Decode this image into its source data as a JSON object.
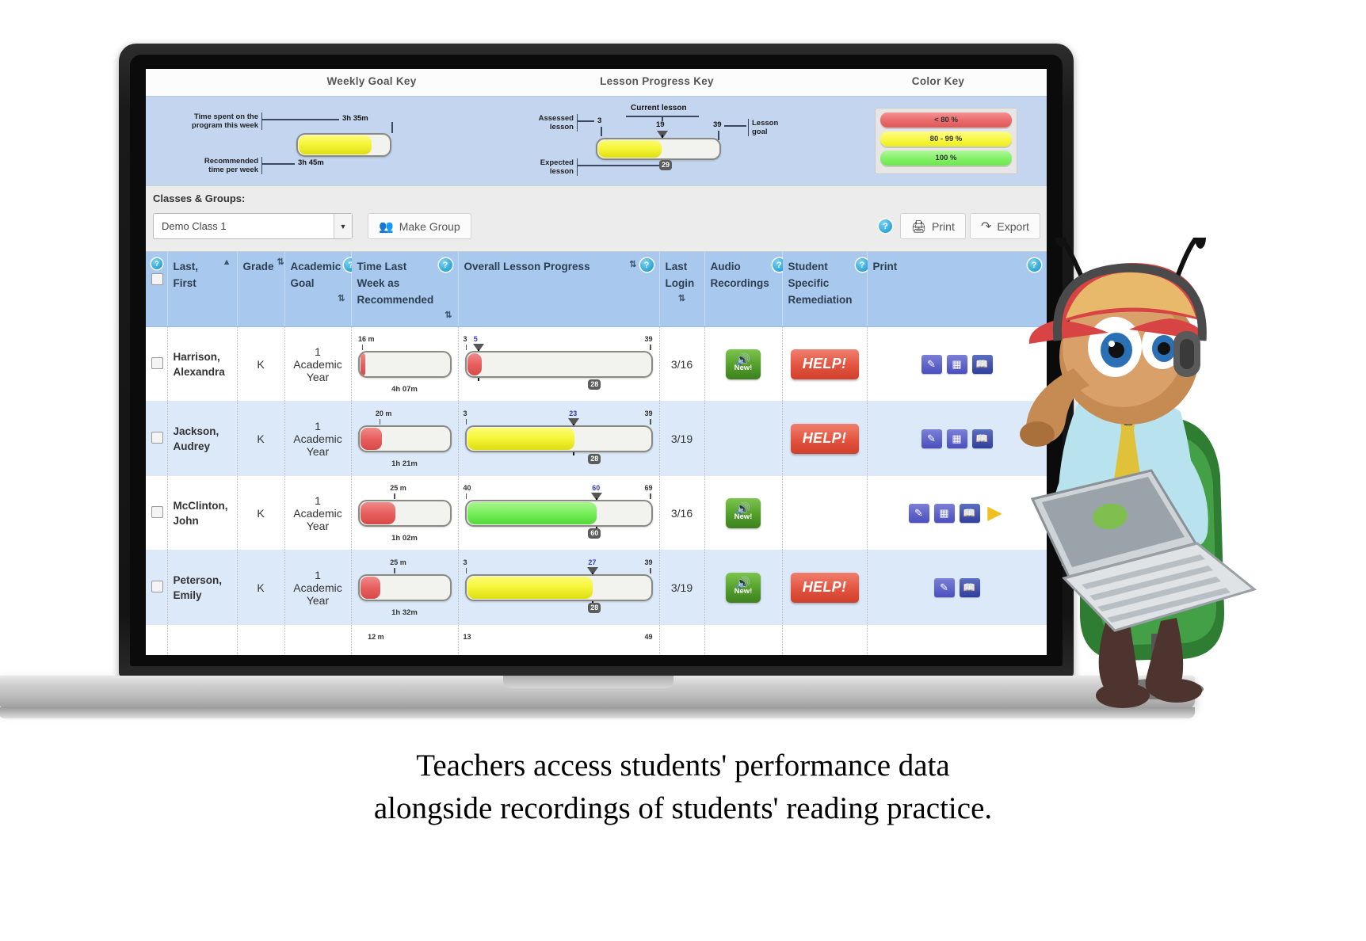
{
  "caption": {
    "line1": "Teachers access students' performance data",
    "line2": "alongside recordings of students' reading practice."
  },
  "keys": {
    "weekly_goal_title": "Weekly Goal Key",
    "lesson_progress_title": "Lesson Progress Key",
    "color_key_title": "Color Key",
    "weekly_goal": {
      "label_time_spent": "Time spent on the\nprogram this week",
      "value_time_spent": "3h 35m",
      "label_recommended": "Recommended\ntime per week",
      "value_recommended": "3h 45m"
    },
    "lesson_progress": {
      "label_assessed": "Assessed\nlesson",
      "label_expected": "Expected\nlesson",
      "label_current": "Current lesson",
      "label_goal": "Lesson\ngoal",
      "value_assessed": "3",
      "value_current": "19",
      "value_goal": "39",
      "value_expected": "29"
    },
    "color_key": {
      "items": [
        {
          "label": "< 80 %",
          "color": "#e96a6a"
        },
        {
          "label": "80 - 99 %",
          "color": "#f7f742"
        },
        {
          "label": "100 %",
          "color": "#83f067"
        }
      ]
    }
  },
  "toolbar": {
    "classes_label": "Classes & Groups:",
    "selected_class": "Demo Class 1",
    "make_group_label": "Make Group",
    "print_label": "Print",
    "export_label": "Export",
    "help_char": "?"
  },
  "table": {
    "columns": [
      {
        "label": "Last, First",
        "sort": "▲",
        "help": false
      },
      {
        "label": "Grade",
        "sort": "⇅",
        "help": true
      },
      {
        "label": "Academic Goal",
        "sort": "⇅",
        "help": true
      },
      {
        "label": "Time Last Week as Recommended",
        "sort": "⇅",
        "help": true
      },
      {
        "label": "Overall Lesson Progress",
        "sort": "⇅",
        "help": true
      },
      {
        "label": "Last Login",
        "sort": "⇅",
        "help": false
      },
      {
        "label": "Audio Recordings",
        "sort": "",
        "help": true
      },
      {
        "label": "Student Specific Remediation",
        "sort": "",
        "help": true
      },
      {
        "label": "Print",
        "sort": "",
        "help": true
      }
    ],
    "rows": [
      {
        "name": "Harrison, Alexandra",
        "grade": "K",
        "academic_goal": "1 Academic Year",
        "time_top_label": "16 m",
        "time_under_label": "4h 07m",
        "time_fill_pct": 6,
        "time_fill_color": "red",
        "time_tick_pct": 6,
        "lesson_start": "3",
        "lesson_end": "39",
        "lesson_current": "5",
        "lesson_expected": "28",
        "lesson_fill_pct": 8,
        "lesson_fill_color": "red",
        "lesson_current_pct": 8,
        "lesson_expected_pct": 70,
        "last_login": "3/16",
        "audio": "New!",
        "remediation": "HELP!",
        "print_icons": [
          "report-icon",
          "chart-icon",
          "book-icon"
        ]
      },
      {
        "name": "Jackson, Audrey",
        "grade": "K",
        "academic_goal": "1 Academic Year",
        "time_top_label": "20 m",
        "time_under_label": "1h 21m",
        "time_fill_pct": 24,
        "time_fill_color": "red",
        "time_tick_pct": 24,
        "lesson_start": "3",
        "lesson_end": "39",
        "lesson_current": "23",
        "lesson_expected": "28",
        "lesson_fill_pct": 58,
        "lesson_fill_color": "yellow",
        "lesson_current_pct": 58,
        "lesson_expected_pct": 70,
        "last_login": "3/19",
        "audio": "",
        "remediation": "HELP!",
        "print_icons": [
          "report-icon",
          "chart-icon",
          "book-icon"
        ]
      },
      {
        "name": "McClinton, John",
        "grade": "K",
        "academic_goal": "1 Academic Year",
        "time_top_label": "25 m",
        "time_under_label": "1h 02m",
        "time_fill_pct": 39,
        "time_fill_color": "red",
        "time_tick_pct": 39,
        "lesson_start": "40",
        "lesson_end": "69",
        "lesson_current": "60",
        "lesson_expected": "60",
        "lesson_fill_pct": 70,
        "lesson_fill_color": "green",
        "lesson_current_pct": 70,
        "lesson_expected_pct": 70,
        "last_login": "3/16",
        "audio": "New!",
        "remediation": "",
        "print_icons": [
          "report-icon",
          "chart-icon",
          "book-icon",
          "flag-icon"
        ]
      },
      {
        "name": "Peterson, Emily",
        "grade": "K",
        "academic_goal": "1 Academic Year",
        "time_top_label": "25 m",
        "time_under_label": "1h 32m",
        "time_fill_pct": 22,
        "time_fill_color": "red",
        "time_tick_pct": 39,
        "lesson_start": "3",
        "lesson_end": "39",
        "lesson_current": "27",
        "lesson_expected": "28",
        "lesson_fill_pct": 68,
        "lesson_fill_color": "yellow",
        "lesson_current_pct": 68,
        "lesson_expected_pct": 70,
        "last_login": "3/19",
        "audio": "New!",
        "remediation": "HELP!",
        "print_icons": [
          "report-icon",
          "book-icon"
        ]
      }
    ],
    "partial_row": {
      "time_top_label": "12 m",
      "lesson_start": "13",
      "lesson_end": "49"
    }
  }
}
